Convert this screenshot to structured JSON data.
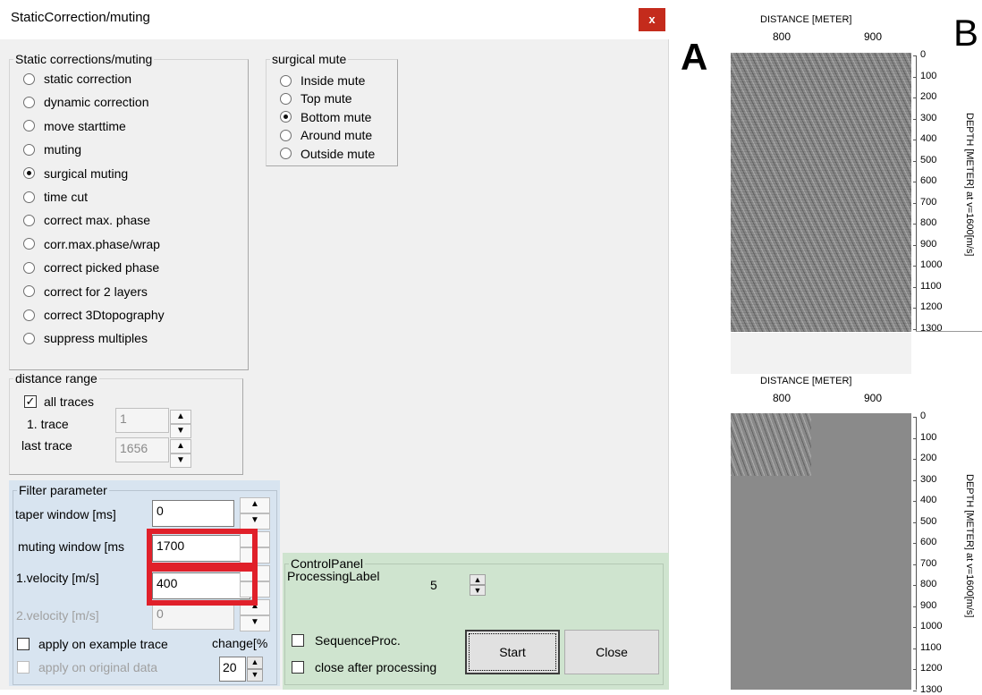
{
  "dialog": {
    "title": "StaticCorrection/muting",
    "close_glyph": "x"
  },
  "static_group": {
    "legend": "Static corrections/muting",
    "options": [
      {
        "label": "static correction",
        "selected": false
      },
      {
        "label": "dynamic correction",
        "selected": false
      },
      {
        "label": "move starttime",
        "selected": false
      },
      {
        "label": "muting",
        "selected": false
      },
      {
        "label": "surgical muting",
        "selected": true
      },
      {
        "label": "time cut",
        "selected": false
      },
      {
        "label": "correct max. phase",
        "selected": false
      },
      {
        "label": "corr.max.phase/wrap",
        "selected": false
      },
      {
        "label": "correct picked phase",
        "selected": false
      },
      {
        "label": "correct for 2 layers",
        "selected": false
      },
      {
        "label": "correct 3Dtopography",
        "selected": false
      },
      {
        "label": "suppress multiples",
        "selected": false
      }
    ]
  },
  "surgical_group": {
    "legend": "surgical mute",
    "options": [
      {
        "label": "Inside mute",
        "selected": false
      },
      {
        "label": "Top mute",
        "selected": false
      },
      {
        "label": "Bottom mute",
        "selected": true
      },
      {
        "label": "Around mute",
        "selected": false
      },
      {
        "label": "Outside mute",
        "selected": false
      }
    ]
  },
  "distance_group": {
    "legend": "distance range",
    "all_traces_label": "all traces",
    "all_traces_checked": true,
    "first_trace_label": "1. trace",
    "first_trace_value": "1",
    "last_trace_label": "last trace",
    "last_trace_value": "1656"
  },
  "filter_group": {
    "legend": "Filter parameter",
    "taper_label": "taper window [ms]",
    "taper_value": "0",
    "muting_label": "muting window [ms",
    "muting_value": "1700",
    "velocity1_label": "1.velocity [m/s]",
    "velocity1_value": "400",
    "velocity2_label": "2.velocity [m/s]",
    "velocity2_value": "0",
    "apply_example_label": "apply on example trace",
    "apply_original_label": "apply on original data",
    "change_label": "change[%",
    "change_value": "20"
  },
  "control_panel": {
    "legend": "ControlPanel",
    "processing_label": "ProcessingLabel",
    "processing_value": "5",
    "sequence_label": "SequenceProc.",
    "close_after_label": "close after processing",
    "start_label": "Start",
    "close_label": "Close"
  },
  "highlight_color": "#e0202a",
  "panel_a": {
    "letter": "A",
    "axis_title": "DISTANCE [METER]",
    "x_ticks": [
      "800",
      "900"
    ],
    "y_ticks": [
      "0",
      "100",
      "200",
      "300",
      "400",
      "500",
      "600",
      "700",
      "800",
      "900",
      "1000",
      "1100",
      "1200",
      "1300"
    ],
    "y_axis_title": "DEPTH [METER] at v=1600[m/s]"
  },
  "panel_b": {
    "letter": "B",
    "axis_title": "DISTANCE [METER]",
    "x_ticks": [
      "800",
      "900"
    ],
    "y_ticks": [
      "0",
      "100",
      "200",
      "300",
      "400",
      "500",
      "600",
      "700",
      "800",
      "900",
      "1000",
      "1100",
      "1200",
      "1300"
    ],
    "y_axis_title": "DEPTH [METER] at v=1600[m/s]"
  }
}
